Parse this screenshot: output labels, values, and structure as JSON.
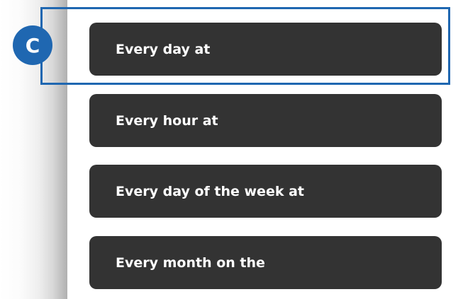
{
  "callout": {
    "label": "C",
    "color": "#1f67b1"
  },
  "options": [
    {
      "label": "Every day at"
    },
    {
      "label": "Every hour at"
    },
    {
      "label": "Every day of the week at"
    },
    {
      "label": "Every month on the"
    }
  ],
  "colors": {
    "option_bg": "#333333",
    "option_text": "#ffffff",
    "highlight": "#1f67b1"
  }
}
